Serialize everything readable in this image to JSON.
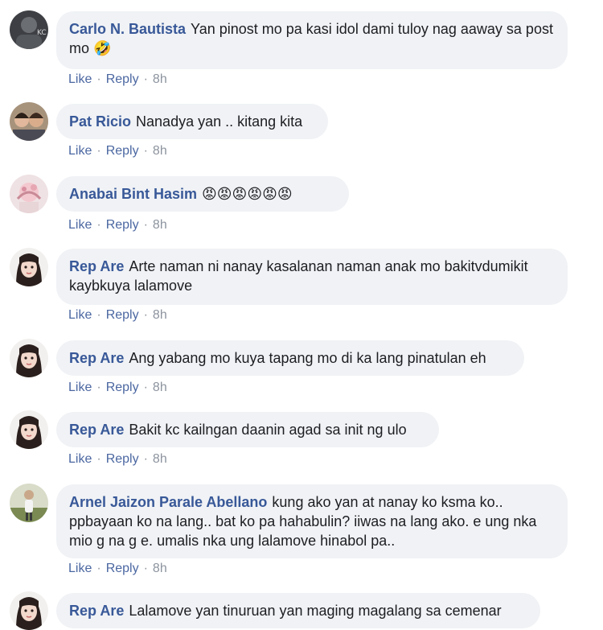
{
  "actions": {
    "like": "Like",
    "reply": "Reply",
    "sep": "·"
  },
  "comments": [
    {
      "author": "Carlo N. Bautista",
      "text": "Yan pinost mo pa kasi idol dami tuloy nag aaway sa post mo",
      "emoji": "🤣",
      "time": "8h"
    },
    {
      "author": "Pat Ricio",
      "text": "Nanadya yan .. kitang kita",
      "emoji": "",
      "time": "8h"
    },
    {
      "author": "Anabai Bint Hasim",
      "text": "",
      "emoji": "😡😡😡😡😡😡",
      "time": "8h"
    },
    {
      "author": "Rep Are",
      "text": "Arte naman ni nanay kasalanan naman anak mo bakitvdumikit kaybkuya lalamove",
      "emoji": "",
      "time": "8h"
    },
    {
      "author": "Rep Are",
      "text": "Ang yabang mo kuya tapang mo di ka lang pinatulan eh",
      "emoji": "",
      "time": "8h"
    },
    {
      "author": "Rep Are",
      "text": "Bakit kc kailngan daanin agad sa init ng ulo",
      "emoji": "",
      "time": "8h"
    },
    {
      "author": "Arnel Jaizon Parale Abellano",
      "text": "kung ako yan at nanay ko ksma ko.. ppbayaan ko na lang.. bat ko pa hahabulin? iiwas na lang ako. e ung nka mio g na g e. umalis nka ung lalamove hinabol pa..",
      "emoji": "",
      "time": "8h"
    },
    {
      "author": "Rep Are",
      "text": "Lalamove yan tinuruan yan maging magalang sa cemenar",
      "emoji": "",
      "time": ""
    }
  ]
}
